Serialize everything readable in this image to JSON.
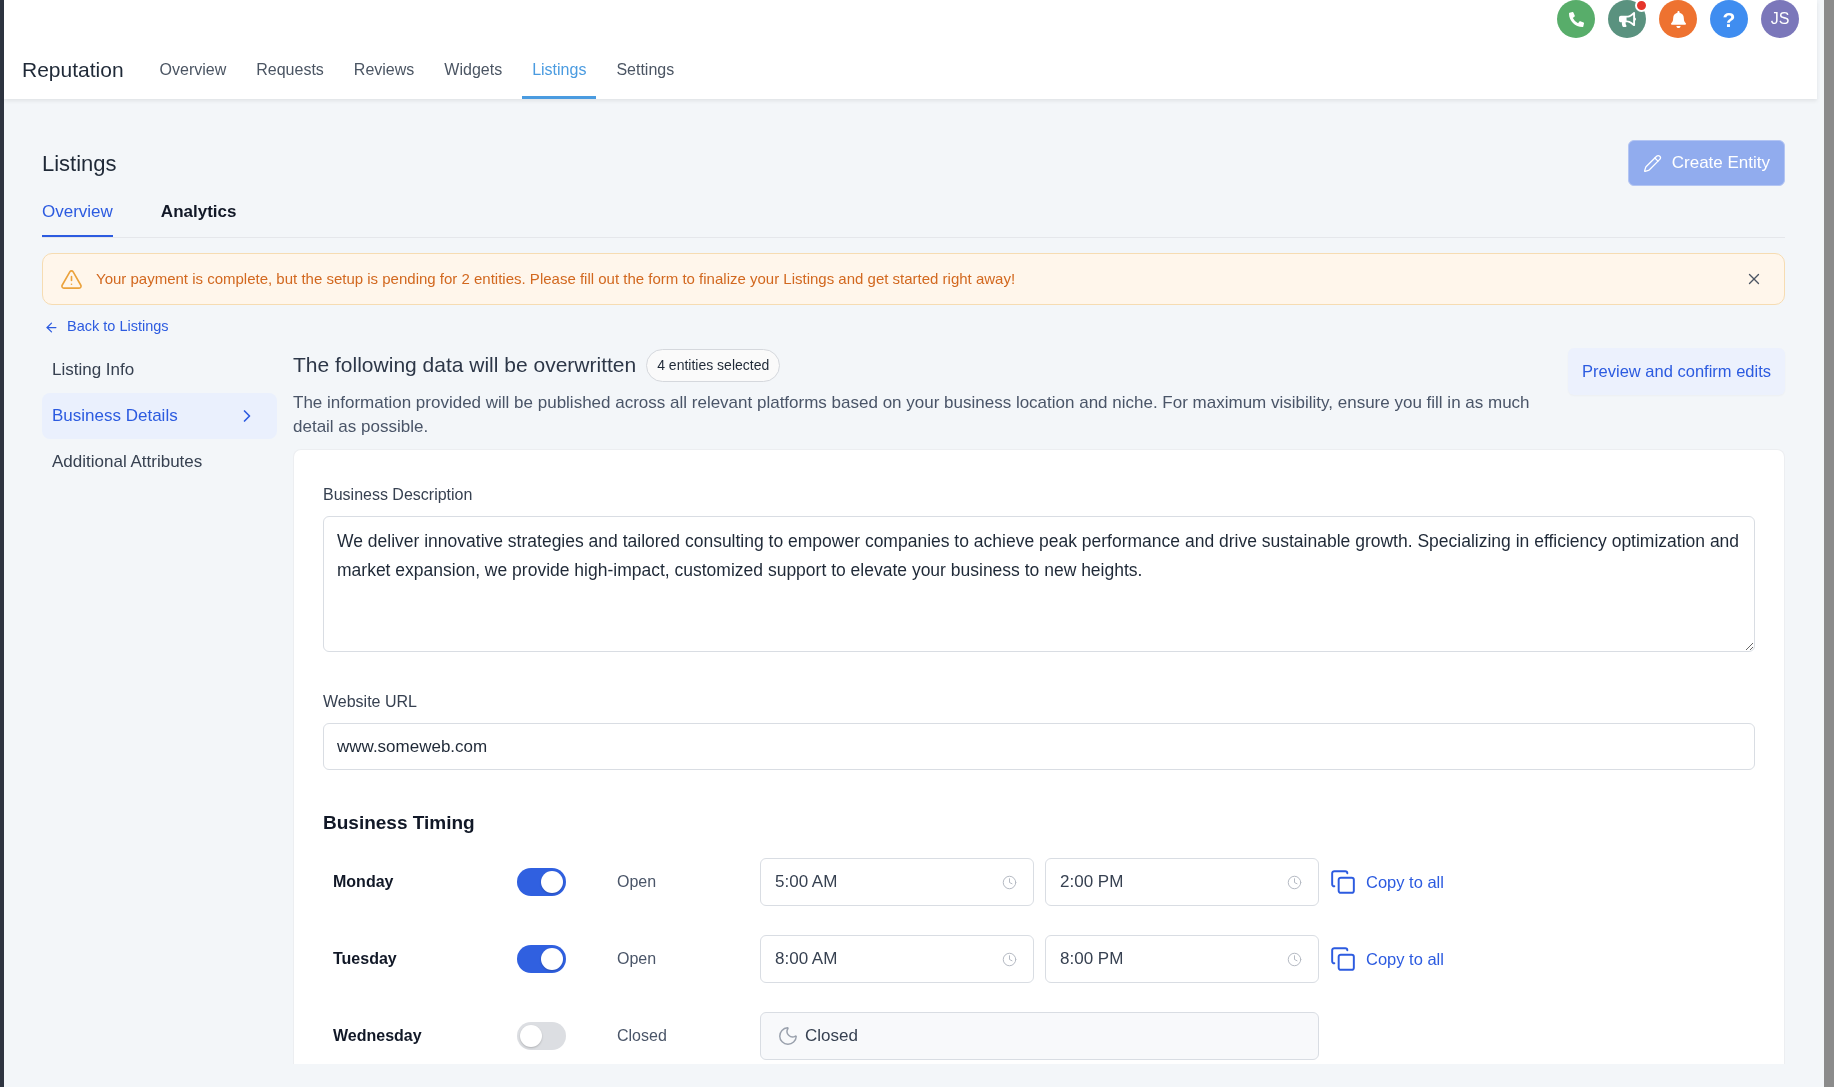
{
  "header": {
    "title": "Reputation",
    "nav": [
      {
        "label": "Overview",
        "selected": false
      },
      {
        "label": "Requests",
        "selected": false
      },
      {
        "label": "Reviews",
        "selected": false
      },
      {
        "label": "Widgets",
        "selected": false
      },
      {
        "label": "Listings",
        "selected": true
      },
      {
        "label": "Settings",
        "selected": false
      }
    ],
    "actions": [
      {
        "kind": "phone",
        "notification": false
      },
      {
        "kind": "megaphone",
        "notification": true
      },
      {
        "kind": "bell",
        "notification": false
      },
      {
        "kind": "help",
        "label": "?",
        "notification": false
      },
      {
        "kind": "avatar",
        "initials": "JS",
        "notification": false
      }
    ]
  },
  "page": {
    "title": "Listings",
    "create_button": "Create Entity",
    "tabs": [
      {
        "label": "Overview",
        "selected": true
      },
      {
        "label": "Analytics",
        "selected": false
      }
    ]
  },
  "alert": {
    "message": "Your payment is complete, but the setup is pending for 2 entities. Please fill out the form to finalize your Listings and get started right away!"
  },
  "back_link": "Back to Listings",
  "sidebar": {
    "items": [
      {
        "label": "Listing Info",
        "selected": false
      },
      {
        "label": "Business Details",
        "selected": true
      },
      {
        "label": "Additional Attributes",
        "selected": false
      }
    ]
  },
  "content": {
    "heading": "The following data will be overwritten",
    "badge": "4 entities selected",
    "preview_button": "Preview and confirm edits",
    "description": "The information provided will be published across all relevant platforms based on your business location and niche. For maximum visibility, ensure you fill in as much detail as possible.",
    "business_description": {
      "label": "Business Description",
      "value": "We deliver innovative strategies and tailored consulting to empower companies to achieve peak performance and drive sustainable growth. Specializing in efficiency optimization and market expansion, we provide high-impact, customized support to elevate your business to new heights."
    },
    "website_url": {
      "label": "Website URL",
      "value": "www.someweb.com"
    },
    "business_timing": {
      "title": "Business Timing",
      "days": [
        {
          "day": "Monday",
          "open": true,
          "status": "Open",
          "from": "5:00 AM",
          "to": "2:00 PM",
          "copy_label": "Copy to all"
        },
        {
          "day": "Tuesday",
          "open": true,
          "status": "Open",
          "from": "8:00 AM",
          "to": "8:00 PM",
          "copy_label": "Copy to all"
        },
        {
          "day": "Wednesday",
          "open": false,
          "status": "Closed",
          "closed_label": "Closed"
        }
      ]
    }
  }
}
